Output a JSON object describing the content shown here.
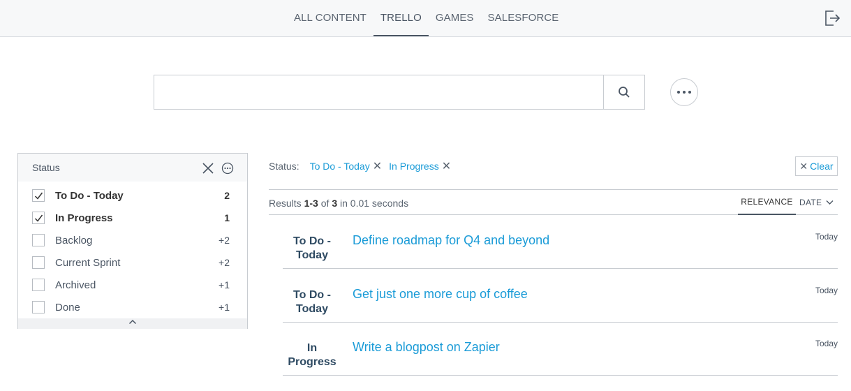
{
  "nav": {
    "tabs": [
      {
        "label": "ALL CONTENT"
      },
      {
        "label": "TRELLO"
      },
      {
        "label": "GAMES"
      },
      {
        "label": "SALESFORCE"
      }
    ],
    "active_tab": "TRELLO",
    "logout_icon": "logout-icon"
  },
  "search": {
    "value": "",
    "placeholder": "",
    "button_icon": "search-icon",
    "more_icon": "more-options-icon"
  },
  "facet": {
    "title": "Status",
    "values": [
      {
        "label": "To Do - Today",
        "count": "2",
        "selected": true
      },
      {
        "label": "In Progress",
        "count": "1",
        "selected": true
      },
      {
        "label": "Backlog",
        "count": "+2",
        "selected": false
      },
      {
        "label": "Current Sprint",
        "count": "+2",
        "selected": false
      },
      {
        "label": "Archived",
        "count": "+1",
        "selected": false
      },
      {
        "label": "Done",
        "count": "+1",
        "selected": false
      }
    ]
  },
  "breadcrumb": {
    "label": "Status:",
    "values": [
      "To Do - Today",
      "In Progress"
    ],
    "clear_label": "Clear"
  },
  "summary": {
    "prefix": "Results ",
    "first": "1",
    "separator": "-",
    "last": "3",
    "of": " of ",
    "total": "3",
    "in": " in ",
    "duration": "0.01 seconds"
  },
  "sort": {
    "relevance": "RELEVANCE",
    "date": "DATE"
  },
  "results": [
    {
      "badge_line1": "To Do -",
      "badge_line2": "Today",
      "title": "Define roadmap for Q4 and beyond",
      "date": "Today"
    },
    {
      "badge_line1": "To Do -",
      "badge_line2": "Today",
      "title": "Get just one more cup of coffee",
      "date": "Today"
    },
    {
      "badge_line1": "In",
      "badge_line2": "Progress",
      "title": "Write a blogpost on Zapier",
      "date": "Today"
    }
  ],
  "colors": {
    "link": "#1a9bd7",
    "badge": "#2e4a62",
    "border": "#c8ccd1"
  }
}
